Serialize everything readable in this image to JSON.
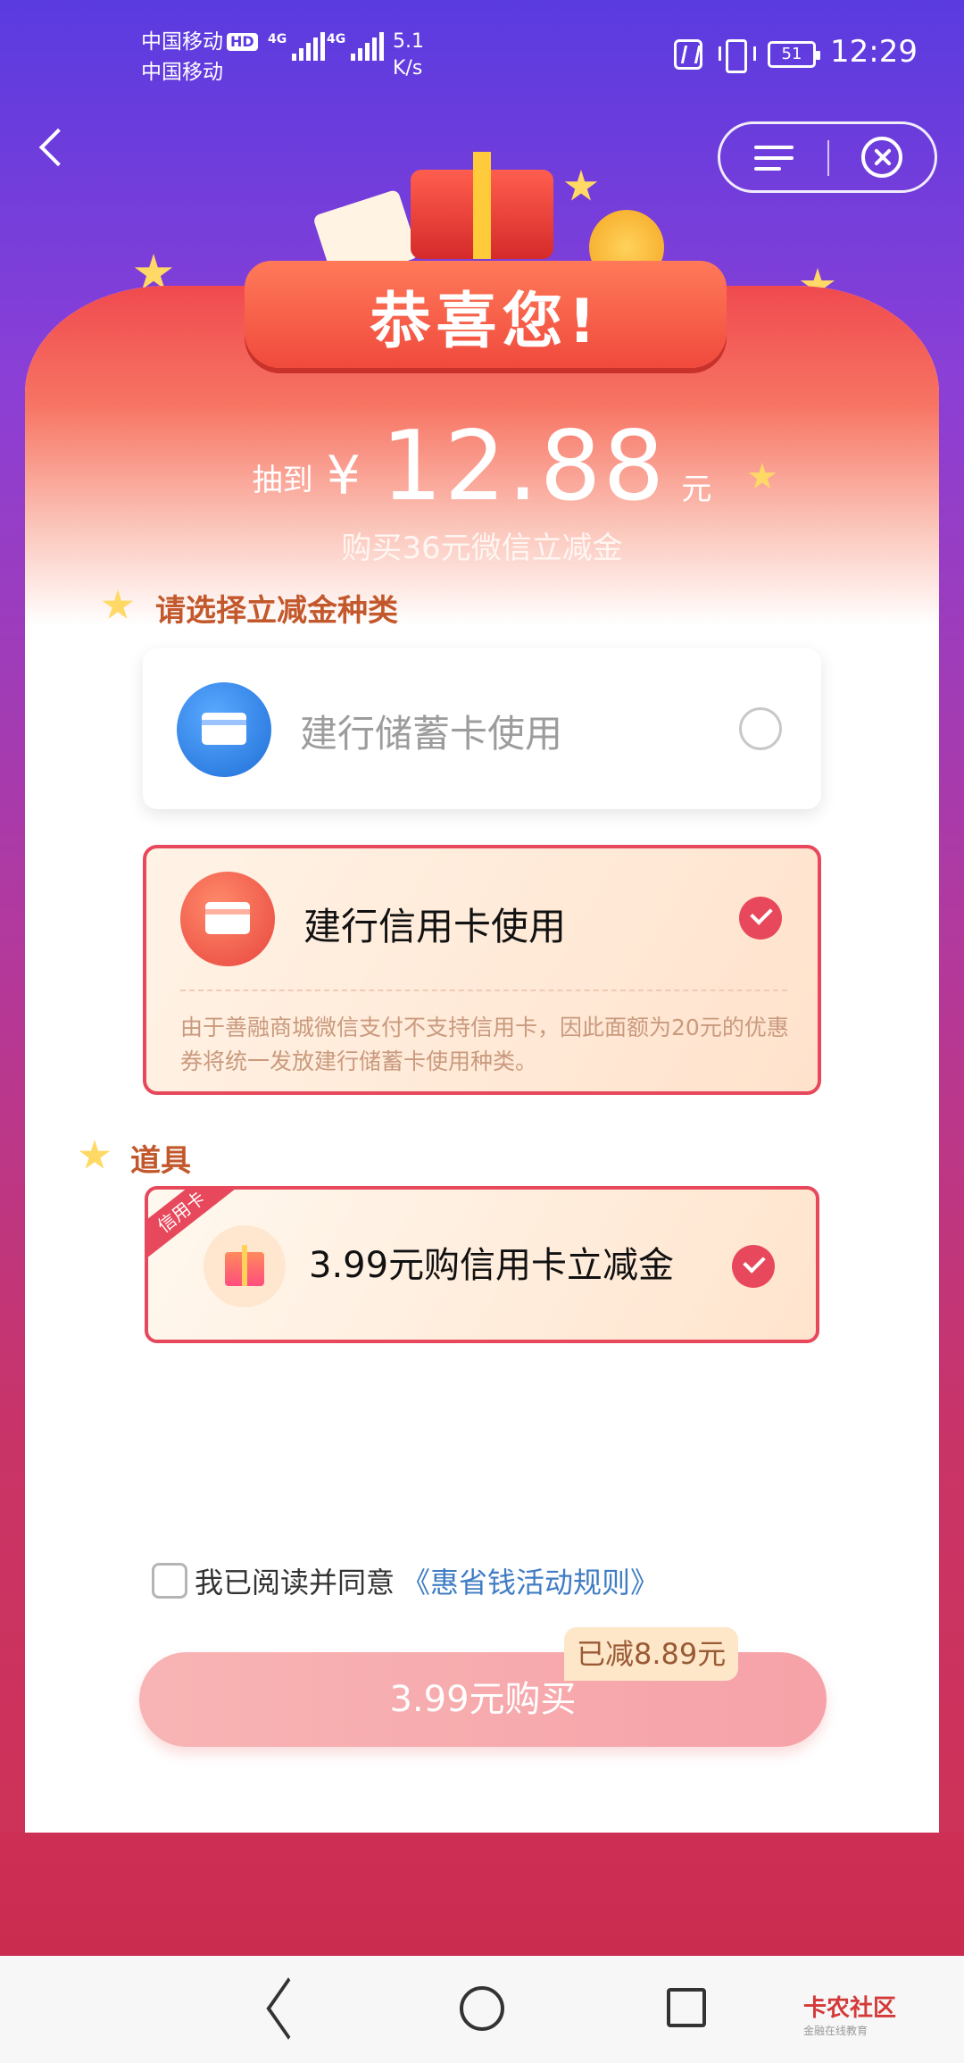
{
  "status_bar": {
    "carrier_1": "中国移动",
    "carrier_2": "中国移动",
    "hd": "HD",
    "network_1": "4G",
    "network_2": "4G",
    "speed_value": "5.1",
    "speed_unit": "K/s",
    "battery": "51",
    "time": "12:29"
  },
  "header": {
    "back_icon": "chevron-left-icon",
    "menu_icon": "menu-icon",
    "close_icon": "close-circle-icon"
  },
  "banner": {
    "title": "恭喜您!"
  },
  "prize": {
    "prefix": "抽到",
    "currency": "¥",
    "amount": "12.88",
    "unit": "元",
    "subtitle": "购买36元微信立减金"
  },
  "choose_section": {
    "title": "请选择立减金种类",
    "options": [
      {
        "label": "建行储蓄卡使用",
        "selected": false,
        "icon": "bank-card-icon"
      },
      {
        "label": "建行信用卡使用",
        "selected": true,
        "icon": "bank-card-icon",
        "note": "由于善融商城微信支付不支持信用卡，因此面额为20元的优惠券将统一发放建行储蓄卡使用种类。"
      }
    ]
  },
  "props_section": {
    "title": "道具",
    "item": {
      "tag": "信用卡",
      "label": "3.99元购信用卡立减金",
      "selected": true,
      "icon": "gift-icon"
    }
  },
  "agreement": {
    "text": "我已阅读并同意",
    "link": "《惠省钱活动规则》",
    "checked": false
  },
  "purchase": {
    "button_label": "3.99元购买",
    "discount_badge": "已减8.89元"
  },
  "nav_bar": {
    "back_icon": "triangle-back-icon",
    "home_icon": "circle-home-icon",
    "recent_icon": "square-recent-icon",
    "watermark": "卡农社区",
    "watermark_sub": "金融在线教育"
  },
  "colors": {
    "accent": "#e8485b",
    "section_title": "#c2582b",
    "link": "#3f7cc4"
  }
}
